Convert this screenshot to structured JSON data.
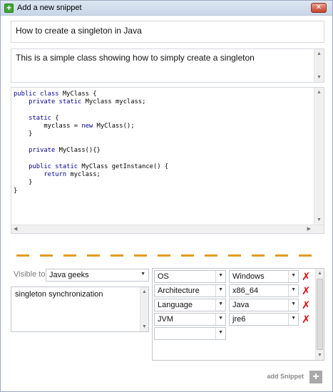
{
  "window": {
    "title": "Add a new snippet",
    "close_glyph": "✕",
    "title_icon_glyph": "+"
  },
  "snippet": {
    "title": "How to create a singleton in Java",
    "description": "This is a simple class showing how to simply create a singleton",
    "code_lines": [
      [
        {
          "t": "public class ",
          "k": true
        },
        {
          "t": "MyClass {",
          "k": false
        }
      ],
      [
        {
          "t": "    private static ",
          "k": true
        },
        {
          "t": "Myclass myclass;",
          "k": false
        }
      ],
      [
        {
          "t": "",
          "k": false
        }
      ],
      [
        {
          "t": "    static ",
          "k": true
        },
        {
          "t": "{",
          "k": false
        }
      ],
      [
        {
          "t": "        myclass = ",
          "k": false
        },
        {
          "t": "new ",
          "k": true
        },
        {
          "t": "MyClass();",
          "k": false
        }
      ],
      [
        {
          "t": "    }",
          "k": false
        }
      ],
      [
        {
          "t": "",
          "k": false
        }
      ],
      [
        {
          "t": "    private ",
          "k": true
        },
        {
          "t": "MyClass(){}",
          "k": false
        }
      ],
      [
        {
          "t": "",
          "k": false
        }
      ],
      [
        {
          "t": "    public static ",
          "k": true
        },
        {
          "t": "MyClass getInstance() {",
          "k": false
        }
      ],
      [
        {
          "t": "        return ",
          "k": true
        },
        {
          "t": "myclass;",
          "k": false
        }
      ],
      [
        {
          "t": "    }",
          "k": false
        }
      ],
      [
        {
          "t": "}",
          "k": false
        }
      ]
    ]
  },
  "visibility": {
    "label": "Visible to",
    "value": "Java geeks"
  },
  "tags": {
    "value": "singleton synchronization"
  },
  "metadata": {
    "rows": [
      {
        "key": "OS",
        "value": "Windows"
      },
      {
        "key": "Architecture",
        "value": "x86_64"
      },
      {
        "key": "Language",
        "value": "Java"
      },
      {
        "key": "JVM",
        "value": "jre6"
      }
    ],
    "empty_row_key": "",
    "remove_glyph": "✗"
  },
  "actions": {
    "add_snippet_label": "add Snippet",
    "add_icon_glyph": "+"
  },
  "colors": {
    "separator": "#e39b1e",
    "remove": "#e01212",
    "keyword": "#00009e"
  },
  "icons": {
    "title_icon": "add-icon",
    "close": "close-icon",
    "dropdown": "chevron-down-icon",
    "remove": "remove-icon",
    "add": "plus-icon"
  }
}
